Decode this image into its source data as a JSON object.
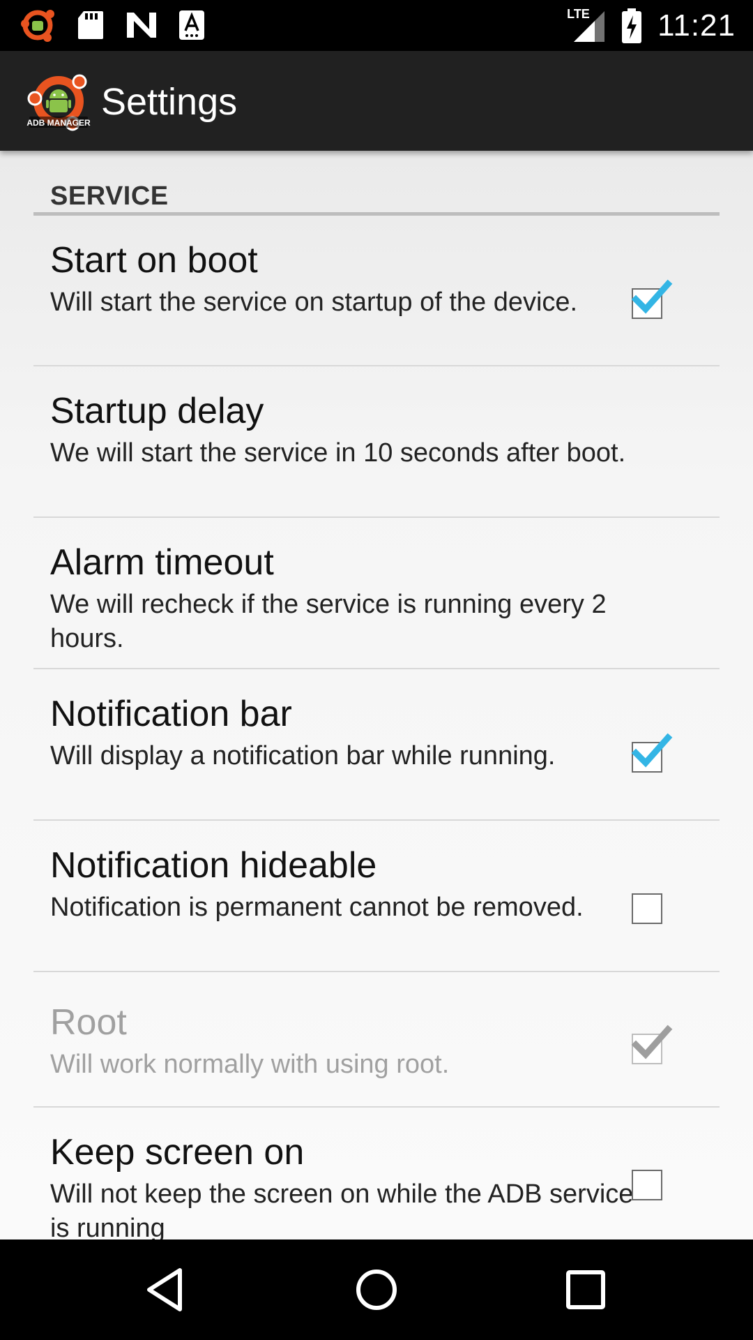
{
  "status_bar": {
    "time": "11:21",
    "network": "LTE",
    "icons": [
      "adb-manager-notification-icon",
      "sd-card-icon",
      "n-logo-icon",
      "keyboard-a-icon",
      "signal-icon",
      "battery-charging-icon"
    ]
  },
  "app_bar": {
    "title": "Settings",
    "logo_text": "ADB MANAGER"
  },
  "section": {
    "header": "SERVICE"
  },
  "preferences": [
    {
      "title": "Start on boot",
      "summary": "Will start the service on startup of the device.",
      "checkbox": true,
      "checked": true,
      "enabled": true
    },
    {
      "title": "Startup delay",
      "summary": "We will start the service in 10 seconds after boot.",
      "checkbox": false,
      "enabled": true
    },
    {
      "title": "Alarm timeout",
      "summary": "We will recheck if the service is running every 2 hours.",
      "checkbox": false,
      "enabled": true
    },
    {
      "title": "Notification bar",
      "summary": "Will display a notification bar while running.",
      "checkbox": true,
      "checked": true,
      "enabled": true
    },
    {
      "title": "Notification hideable",
      "summary": "Notification is permanent cannot be removed.",
      "checkbox": true,
      "checked": false,
      "enabled": true
    },
    {
      "title": "Root",
      "summary": "Will work normally with using root.",
      "checkbox": true,
      "checked": true,
      "enabled": false
    },
    {
      "title": "Keep screen on",
      "summary": "Will not keep the screen on while the ADB service is running",
      "checkbox": true,
      "checked": false,
      "enabled": true
    }
  ],
  "nav_bar": {
    "icons": [
      "back-icon",
      "home-icon",
      "recents-icon"
    ]
  },
  "colors": {
    "check_accent": "#33b5e5",
    "check_disabled": "#9e9e9e",
    "logo_orange": "#e95420",
    "android_green": "#8bc34a"
  }
}
